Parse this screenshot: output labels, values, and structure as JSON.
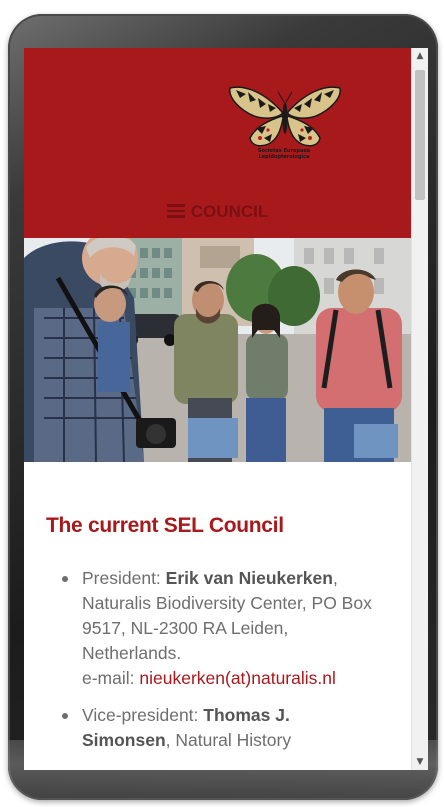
{
  "header": {
    "logo_alt": "butterfly-logo",
    "logo_line1": "Societas Europaea",
    "logo_line2": "Lepidopterologica",
    "nav_label": "COUNCIL",
    "brand_color": "#a8191c"
  },
  "main": {
    "title": "The current SEL Council",
    "members": [
      {
        "role": "President: ",
        "name": "Erik van Nieukerken",
        "details": ", Naturalis Biodiversity Center, PO Box 9517, NL-2300 RA Leiden, Netherlands.",
        "email_label": "e-mail: ",
        "email": "nieukerken(at)naturalis.nl"
      },
      {
        "role": "Vice-president: ",
        "name": "Thomas J.",
        "name_cont": "Simonsen",
        "details": ", Natural History"
      }
    ]
  }
}
